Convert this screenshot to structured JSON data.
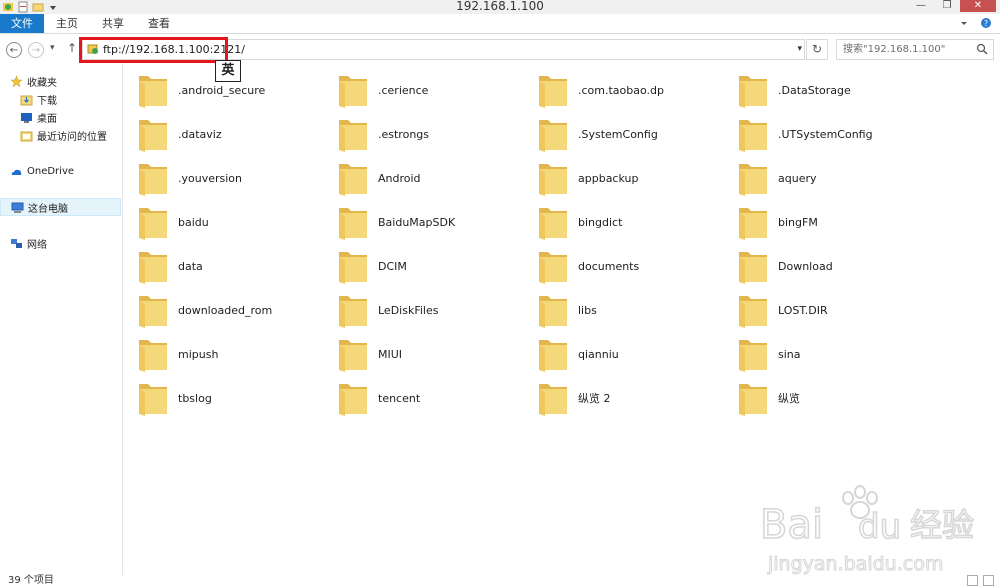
{
  "window": {
    "title": "192.168.1.100"
  },
  "ribbon": {
    "tabs": [
      "文件",
      "主页",
      "共享",
      "查看"
    ]
  },
  "address": {
    "value": "ftp://192.168.1.100:2121/"
  },
  "search": {
    "placeholder": "搜索\"192.168.1.100\""
  },
  "ime": {
    "label": "英"
  },
  "sidebar": {
    "items": [
      {
        "label": "收藏夹",
        "icon": "star-icon"
      },
      {
        "label": "下载",
        "icon": "download-folder-icon"
      },
      {
        "label": "桌面",
        "icon": "desktop-icon"
      },
      {
        "label": "最近访问的位置",
        "icon": "recent-places-icon"
      },
      {
        "label": "OneDrive",
        "icon": "onedrive-icon"
      },
      {
        "label": "这台电脑",
        "icon": "computer-icon",
        "selected": true
      },
      {
        "label": "网络",
        "icon": "network-icon"
      }
    ]
  },
  "folders": [
    ".android_secure",
    ".cerience",
    ".com.taobao.dp",
    ".DataStorage",
    ".dataviz",
    ".estrongs",
    ".SystemConfig",
    ".UTSystemConfig",
    ".youversion",
    "Android",
    "appbackup",
    "aquery",
    "baidu",
    "BaiduMapSDK",
    "bingdict",
    "bingFM",
    "data",
    "DCIM",
    "documents",
    "Download",
    "downloaded_rom",
    "LeDiskFiles",
    "libs",
    "LOST.DIR",
    "mipush",
    "MIUI",
    "qianniu",
    "sina",
    "tbslog",
    "tencent",
    "纵览 2",
    "纵览"
  ],
  "status": {
    "item_count": "39 个项目"
  },
  "watermark": {
    "brand": "Bai",
    "brand2": "du",
    "suffix": "经验",
    "url": "jingyan.baidu.com"
  },
  "colors": {
    "accent": "#1979ca",
    "highlight": "#e3161c",
    "folder": "#f4d879"
  }
}
